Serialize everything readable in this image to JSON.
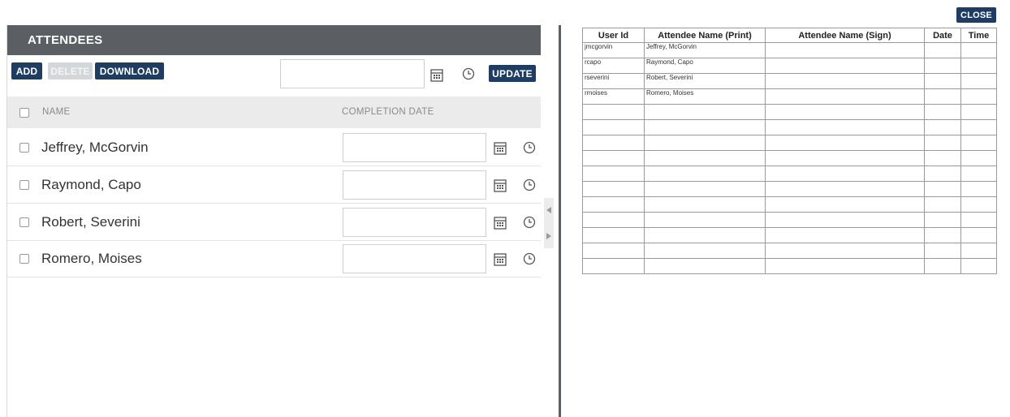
{
  "close_label": "CLOSE",
  "attendees_panel": {
    "title": "ATTENDEES",
    "toolbar": {
      "add_label": "ADD",
      "delete_label": "DELETE",
      "download_label": "DOWNLOAD",
      "update_label": "UPDATE",
      "date_value": ""
    },
    "columns": {
      "name": "NAME",
      "completion_date": "COMPLETION DATE"
    },
    "rows": [
      {
        "name": "Jeffrey, McGorvin",
        "completion_date": ""
      },
      {
        "name": "Raymond, Capo",
        "completion_date": ""
      },
      {
        "name": "Robert, Severini",
        "completion_date": ""
      },
      {
        "name": "Romero, Moises",
        "completion_date": ""
      }
    ]
  },
  "sign_sheet": {
    "headers": [
      "User Id",
      "Attendee Name (Print)",
      "Attendee Name (Sign)",
      "Date",
      "Time"
    ],
    "rows": [
      [
        "jmcgorvin",
        "Jeffrey, McGorvin",
        "",
        "",
        ""
      ],
      [
        "rcapo",
        "Raymond, Capo",
        "",
        "",
        ""
      ],
      [
        "rseverini",
        "Robert, Severini",
        "",
        "",
        ""
      ],
      [
        "rmoises",
        "Romero, Moises",
        "",
        "",
        ""
      ],
      [
        "",
        "",
        "",
        "",
        ""
      ],
      [
        "",
        "",
        "",
        "",
        ""
      ],
      [
        "",
        "",
        "",
        "",
        ""
      ],
      [
        "",
        "",
        "",
        "",
        ""
      ],
      [
        "",
        "",
        "",
        "",
        ""
      ],
      [
        "",
        "",
        "",
        "",
        ""
      ],
      [
        "",
        "",
        "",
        "",
        ""
      ],
      [
        "",
        "",
        "",
        "",
        ""
      ],
      [
        "",
        "",
        "",
        "",
        ""
      ],
      [
        "",
        "",
        "",
        "",
        ""
      ],
      [
        "",
        "",
        "",
        "",
        ""
      ]
    ]
  },
  "icons": {
    "calendar": "calendar-icon",
    "clock": "clock-icon",
    "collapse": "chevron-left-icon",
    "expand": "chevron-right-icon"
  },
  "colors": {
    "button_primary": "#1f3d63",
    "header_bg": "#5b5e63",
    "button_disabled": "#d3d6db"
  }
}
